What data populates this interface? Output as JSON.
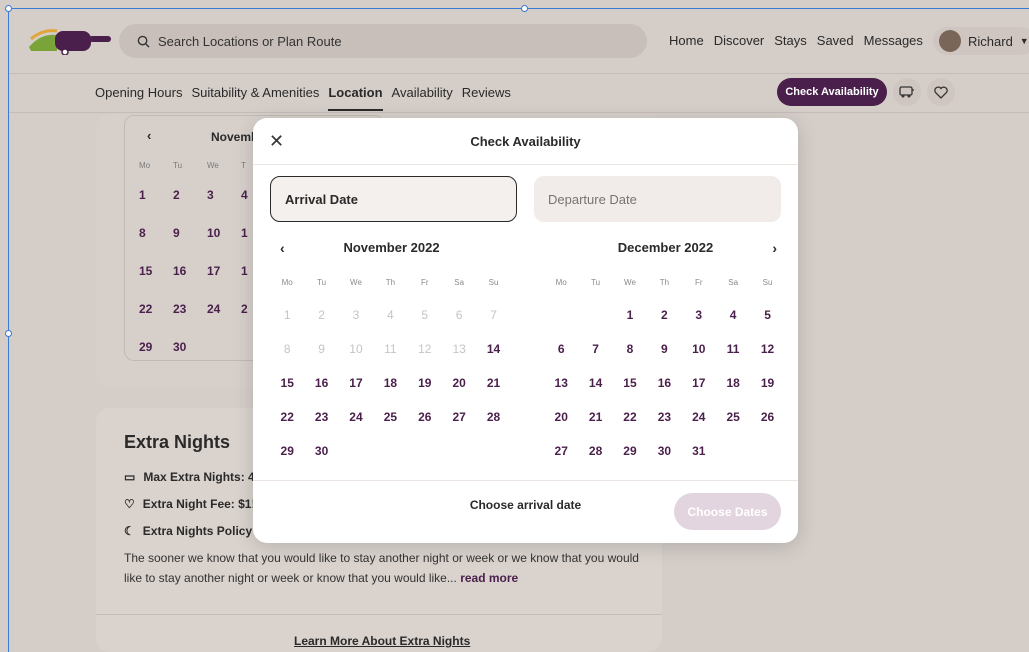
{
  "header": {
    "search_placeholder": "Search Locations or Plan Route",
    "nav": [
      "Home",
      "Discover",
      "Stays",
      "Saved",
      "Messages"
    ],
    "user_name": "Richard"
  },
  "subnav": {
    "tabs": [
      "Opening Hours",
      "Suitability & Amenities",
      "Location",
      "Availability",
      "Reviews"
    ],
    "active": "Location",
    "cta_label": "Check Availability"
  },
  "background": {
    "mini_cal_month": "Novemb",
    "mini_weekdays": [
      "Mo",
      "Tu",
      "We",
      "T"
    ],
    "mini_rows": [
      [
        "1",
        "2",
        "3",
        "4"
      ],
      [
        "8",
        "9",
        "10",
        "1"
      ],
      [
        "15",
        "16",
        "17",
        "1"
      ],
      [
        "22",
        "23",
        "24",
        "2"
      ],
      [
        "29",
        "30"
      ]
    ],
    "extra_title": "Extra Nights",
    "extra_items": [
      "Max Extra Nights: 4",
      "Extra Night Fee: $1!",
      "Extra Nights Policy"
    ],
    "extra_para": "The sooner we know that you would like to stay another night or week or  we know that you would like to stay another night or week or know that you would like...",
    "read_more": "read more",
    "learn_more": "Learn More About Extra Nights"
  },
  "modal": {
    "title": "Check Availability",
    "arrival_label": "Arrival Date",
    "departure_label": "Departure Date",
    "weekdays": [
      "Mo",
      "Tu",
      "We",
      "Th",
      "Fr",
      "Sa",
      "Su"
    ],
    "months": [
      {
        "name": "November 2022",
        "days": [
          {
            "d": "1",
            "dis": true
          },
          {
            "d": "2",
            "dis": true
          },
          {
            "d": "3",
            "dis": true
          },
          {
            "d": "4",
            "dis": true
          },
          {
            "d": "5",
            "dis": true
          },
          {
            "d": "6",
            "dis": true
          },
          {
            "d": "7",
            "dis": true
          },
          {
            "d": "8",
            "dis": true
          },
          {
            "d": "9",
            "dis": true
          },
          {
            "d": "10",
            "dis": true
          },
          {
            "d": "11",
            "dis": true
          },
          {
            "d": "12",
            "dis": true
          },
          {
            "d": "13",
            "dis": true
          },
          {
            "d": "14",
            "dis": false
          },
          {
            "d": "15",
            "dis": false
          },
          {
            "d": "16",
            "dis": false
          },
          {
            "d": "17",
            "dis": false
          },
          {
            "d": "18",
            "dis": false
          },
          {
            "d": "19",
            "dis": false
          },
          {
            "d": "20",
            "dis": false
          },
          {
            "d": "21",
            "dis": false
          },
          {
            "d": "22",
            "dis": false
          },
          {
            "d": "23",
            "dis": false
          },
          {
            "d": "24",
            "dis": false
          },
          {
            "d": "25",
            "dis": false
          },
          {
            "d": "26",
            "dis": false
          },
          {
            "d": "27",
            "dis": false
          },
          {
            "d": "28",
            "dis": false
          },
          {
            "d": "29",
            "dis": false
          },
          {
            "d": "30",
            "dis": false
          }
        ]
      },
      {
        "name": "December 2022",
        "days": [
          {
            "d": ""
          },
          {
            "d": ""
          },
          {
            "d": "1"
          },
          {
            "d": "2"
          },
          {
            "d": "3"
          },
          {
            "d": "4"
          },
          {
            "d": "5"
          },
          {
            "d": "6"
          },
          {
            "d": "7"
          },
          {
            "d": "8"
          },
          {
            "d": "9"
          },
          {
            "d": "10"
          },
          {
            "d": "11"
          },
          {
            "d": "12"
          },
          {
            "d": "13"
          },
          {
            "d": "14"
          },
          {
            "d": "15"
          },
          {
            "d": "16"
          },
          {
            "d": "17"
          },
          {
            "d": "18"
          },
          {
            "d": "19"
          },
          {
            "d": "20"
          },
          {
            "d": "21"
          },
          {
            "d": "22"
          },
          {
            "d": "23"
          },
          {
            "d": "24"
          },
          {
            "d": "25"
          },
          {
            "d": "26"
          },
          {
            "d": "27"
          },
          {
            "d": "28"
          },
          {
            "d": "29"
          },
          {
            "d": "30"
          },
          {
            "d": "31"
          }
        ]
      }
    ],
    "footer_text": "Choose arrival date",
    "choose_label": "Choose Dates"
  },
  "colors": {
    "brand": "#4a1f4b",
    "accent": "#6b2f6b"
  }
}
